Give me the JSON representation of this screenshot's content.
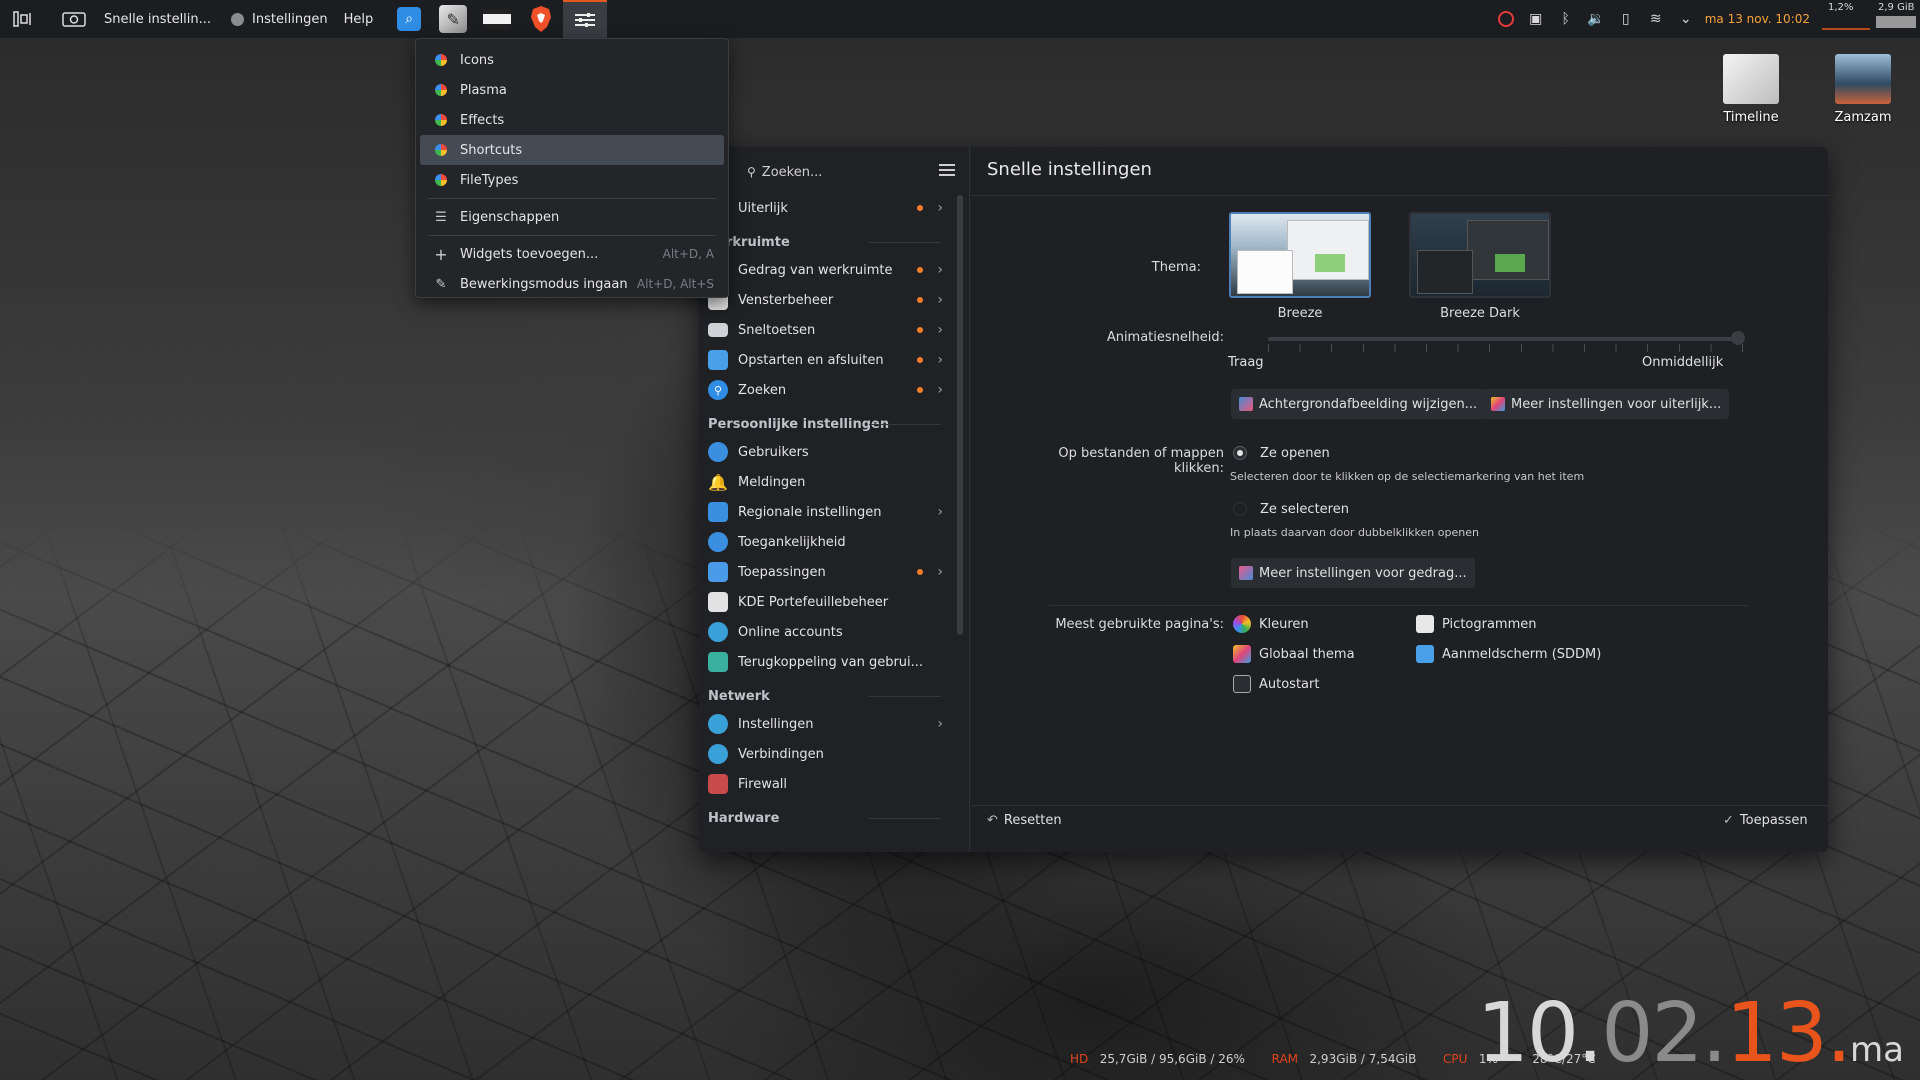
{
  "panel": {
    "window_title": "Snelle instellin...",
    "menu_settings": "Instellingen",
    "menu_help": "Help",
    "clock": "ma 13 nov. 10:02",
    "cpu_stat": "1,2%",
    "mem_stat": "2,9 GiB"
  },
  "context_menu": {
    "items": [
      {
        "label": "Icons"
      },
      {
        "label": "Plasma"
      },
      {
        "label": "Effects"
      },
      {
        "label": "Shortcuts"
      },
      {
        "label": "FileTypes"
      }
    ],
    "properties": "Eigenschappen",
    "add_widgets": "Widgets toevoegen...",
    "add_widgets_shortcut": "Alt+D, A",
    "edit_mode": "Bewerkingsmodus ingaan",
    "edit_mode_shortcut": "Alt+D, Alt+S"
  },
  "sidebar": {
    "search_placeholder": "Zoeken...",
    "items_top": [
      {
        "label": "Uiterlijk"
      }
    ],
    "section_workspace": "rkruimte",
    "workspace_items": [
      {
        "label": "Gedrag van werkruimte"
      },
      {
        "label": "Vensterbeheer"
      },
      {
        "label": "Sneltoetsen"
      },
      {
        "label": "Opstarten en afsluiten"
      },
      {
        "label": "Zoeken"
      }
    ],
    "section_personal": "Persoonlijke instellingen",
    "personal_items": [
      {
        "label": "Gebruikers"
      },
      {
        "label": "Meldingen"
      },
      {
        "label": "Regionale instellingen"
      },
      {
        "label": "Toegankelijkheid"
      },
      {
        "label": "Toepassingen"
      },
      {
        "label": "KDE Portefeuillebeheer"
      },
      {
        "label": "Online accounts"
      },
      {
        "label": "Terugkoppeling van gebrui..."
      }
    ],
    "section_network": "Netwerk",
    "network_items": [
      {
        "label": "Instellingen"
      },
      {
        "label": "Verbindingen"
      },
      {
        "label": "Firewall"
      }
    ],
    "section_hardware": "Hardware"
  },
  "content": {
    "title": "Snelle instellingen",
    "theme_label": "Thema:",
    "theme_breeze": "Breeze",
    "theme_breeze_dark": "Breeze Dark",
    "animation_label": "Animatiesnelheid:",
    "slow": "Traag",
    "instant": "Onmiddellijk",
    "animation_level": 0.99,
    "wallpaper_btn": "Achtergrondafbeelding wijzigen...",
    "more_appearance_btn": "Meer instellingen voor uiterlijk...",
    "click_label": "Op bestanden of mappen klikken:",
    "open_option": "Ze openen",
    "open_desc": "Selecteren door te klikken op de selectiemarkering van het item",
    "select_option": "Ze selecteren",
    "select_desc": "In plaats daarvan door dubbelklikken openen",
    "more_behavior_btn": "Meer instellingen voor gedrag...",
    "most_used_label": "Meest gebruikte pagina's:",
    "pages_col1": [
      "Kleuren",
      "Globaal thema",
      "Autostart"
    ],
    "pages_col2": [
      "Pictogrammen",
      "Aanmeldscherm (SDDM)"
    ],
    "reset": "Resetten",
    "apply": "Toepassen"
  },
  "desktop": {
    "icon1": "Timeline",
    "icon2": "Zamzam"
  },
  "bottom_bar": {
    "hd_label": "HD",
    "hd_value": "25,7GiB / 95,6GiB / 26%",
    "ram_label": "RAM",
    "ram_value": "2,93GiB / 7,54GiB",
    "cpu_label": "CPU",
    "cpu_value": "1%",
    "temp": "28°C/27°C",
    "clock_h": "10.",
    "clock_m": "02.",
    "clock_s": "13.",
    "clock_day": "ma"
  }
}
